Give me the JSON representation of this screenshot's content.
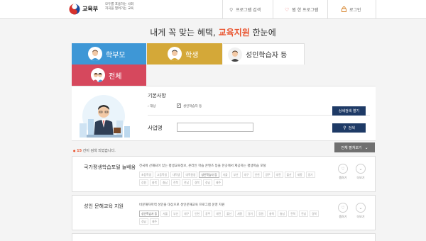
{
  "header": {
    "org_name": "교육부",
    "slogan_line1": "모두를 포용하는 사회",
    "slogan_line2": "지곡을 열어가는 교육",
    "nav": [
      {
        "label": "프로그램 검색",
        "icon": "search-icon"
      },
      {
        "label": "찜 한 프로그램",
        "icon": "heart-icon"
      },
      {
        "label": "로그인",
        "icon": "lock-icon"
      }
    ]
  },
  "headline": {
    "prefix": "내게 꼭 맞는 혜택,",
    "highlight": "교육지원",
    "suffix": "한눈에"
  },
  "tabs": [
    {
      "label": "학부모",
      "color": "#3e97d6"
    },
    {
      "label": "학생",
      "color": "#d4a838"
    },
    {
      "label": "성인학습자 등",
      "color": "#ffffff",
      "selected": true
    },
    {
      "label": "전체",
      "color": "#d6485d"
    }
  ],
  "search": {
    "basic_label": "기본사항",
    "target_label": "대상",
    "target_checkbox": {
      "label": "성인학습자 등",
      "checked": true
    },
    "business_label": "사업명",
    "business_value": "",
    "detail_button": "상세검색 열기",
    "search_button": "검색"
  },
  "results": {
    "count_prefix": "",
    "count": "15",
    "count_suffix": "건이 검색 되었습니다.",
    "expand_label": "전체 펼쳐보기"
  },
  "cards": [
    {
      "title": "국가평생학습포털 늘배움",
      "desc": "전국에 산재되어 있는 평생교육정보, 온라인 학습 콘텐츠 등을 한곳에서 제공하는 평생학습 포털",
      "tags": [
        {
          "label": "초등학생",
          "on": false
        },
        {
          "label": "고등학생",
          "on": false
        },
        {
          "label": "대학생",
          "on": false
        },
        {
          "label": "대학원생",
          "on": false
        },
        {
          "label": "성인학습자 등",
          "on": true
        },
        {
          "label": "서울",
          "on": false
        },
        {
          "label": "부산",
          "on": false
        },
        {
          "label": "대구",
          "on": false
        },
        {
          "label": "인천",
          "on": false
        },
        {
          "label": "광주",
          "on": false
        },
        {
          "label": "대전",
          "on": false
        },
        {
          "label": "울산",
          "on": false
        },
        {
          "label": "세종",
          "on": false
        },
        {
          "label": "경기",
          "on": false
        },
        {
          "label": "강원",
          "on": false
        },
        {
          "label": "충북",
          "on": false
        },
        {
          "label": "충남",
          "on": false
        },
        {
          "label": "전북",
          "on": false
        },
        {
          "label": "전남",
          "on": false
        },
        {
          "label": "경북",
          "on": false
        },
        {
          "label": "경남",
          "on": false
        },
        {
          "label": "제주",
          "on": false
        }
      ],
      "like_label": "찜하기",
      "more_label": "더보기"
    },
    {
      "title": "성인 문해교육 지원",
      "desc": "비문해자학력 성인을 대상으로 성인문해교육 프로그램 운영 지원",
      "tags": [
        {
          "label": "성인학습자 등",
          "on": true
        },
        {
          "label": "서울",
          "on": false
        },
        {
          "label": "부산",
          "on": false
        },
        {
          "label": "대구",
          "on": false
        },
        {
          "label": "인천",
          "on": false
        },
        {
          "label": "광주",
          "on": false
        },
        {
          "label": "대전",
          "on": false
        },
        {
          "label": "울산",
          "on": false
        },
        {
          "label": "세종",
          "on": false
        },
        {
          "label": "경기",
          "on": false
        },
        {
          "label": "강원",
          "on": false
        },
        {
          "label": "충북",
          "on": false
        },
        {
          "label": "충남",
          "on": false
        },
        {
          "label": "전북",
          "on": false
        },
        {
          "label": "전남",
          "on": false
        },
        {
          "label": "경북",
          "on": false
        },
        {
          "label": "경남",
          "on": false
        },
        {
          "label": "제주",
          "on": false
        }
      ],
      "like_label": "찜하기",
      "more_label": "더보기"
    }
  ]
}
